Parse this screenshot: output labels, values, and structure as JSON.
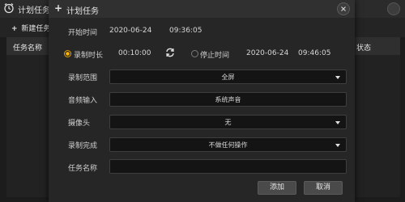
{
  "main_window": {
    "title": "计划任务",
    "new_task_label": "新建任务",
    "table_headers": {
      "name": "任务名称",
      "status": "状态"
    }
  },
  "dialog": {
    "title": "计划任务",
    "start_time": {
      "label": "开始时间",
      "date": "2020-06-24",
      "time": "09:36:05"
    },
    "record_duration": {
      "label": "录制时长",
      "value": "00:10:00",
      "selected": true
    },
    "stop_time": {
      "label": "停止时间",
      "date": "2020-06-24",
      "time": "09:46:05",
      "selected": false
    },
    "fields": {
      "range": {
        "label": "录制范围",
        "value": "全屏"
      },
      "audio": {
        "label": "音频输入",
        "value": "系统声音"
      },
      "camera": {
        "label": "摄像头",
        "value": "无"
      },
      "on_complete": {
        "label": "录制完成",
        "value": "不做任何操作"
      },
      "task_name": {
        "label": "任务名称",
        "value": ""
      }
    },
    "buttons": {
      "add": "添加",
      "cancel": "取消"
    }
  },
  "colors": {
    "accent": "#ffb400",
    "dialog_bg": "#262626",
    "field_bg": "#141414"
  },
  "icons": [
    "clock-icon",
    "close-icon",
    "plus-icon",
    "swap-icon",
    "chevron-down-icon"
  ]
}
